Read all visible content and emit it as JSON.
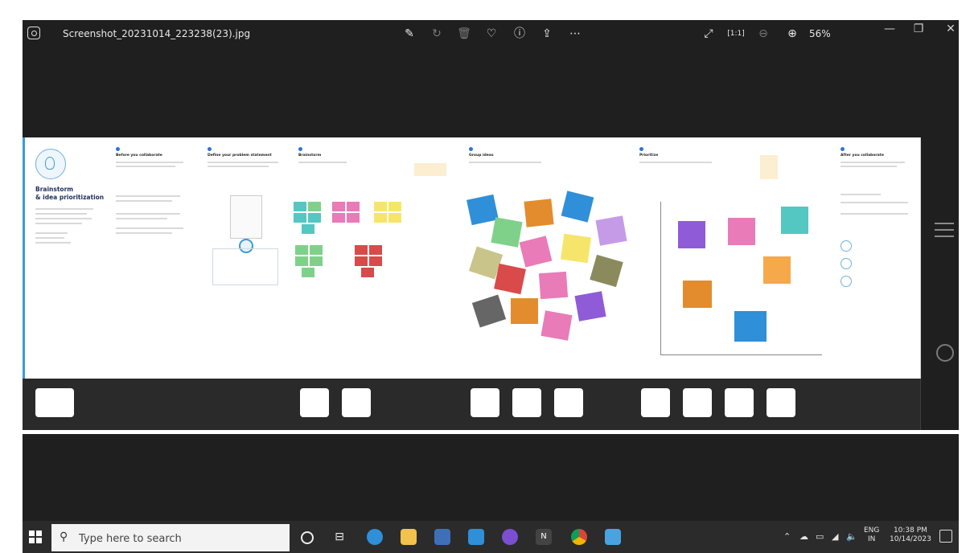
{
  "window": {
    "title": "Screenshot_20231014_223238(23).jpg",
    "zoom": "56%"
  },
  "toolbar_icons": [
    "edit-icon",
    "rotate-icon",
    "delete-icon",
    "favorite-icon",
    "info-icon",
    "share-icon",
    "more-icon"
  ],
  "view_icons": [
    "fullscreen-icon",
    "actual-size-icon",
    "zoom-out-icon",
    "zoom-in-icon"
  ],
  "board": {
    "cover_title": "Brainstorm\n& idea prioritization",
    "panels": [
      {
        "title": "Before you collaborate"
      },
      {
        "title": "Define your problem statement"
      },
      {
        "title": "Brainstorm"
      },
      {
        "title": "Group ideas"
      },
      {
        "title": "Prioritize"
      },
      {
        "title": "After you collaborate"
      }
    ]
  },
  "taskbar": {
    "search_placeholder": "Type here to search",
    "language": "ENG",
    "region": "IN",
    "time": "10:38 PM",
    "date": "10/14/2023"
  },
  "colors": {
    "accent": "#3b9bd6",
    "sticky_yellow": "#f5e66b",
    "sticky_green": "#7fd18a",
    "sticky_teal": "#54c7c2",
    "sticky_pink": "#e87bb8",
    "sticky_red": "#d94a4a",
    "sticky_blue": "#2f8fd8",
    "sticky_purple": "#8f5bd6",
    "sticky_orange": "#e38c2e"
  }
}
